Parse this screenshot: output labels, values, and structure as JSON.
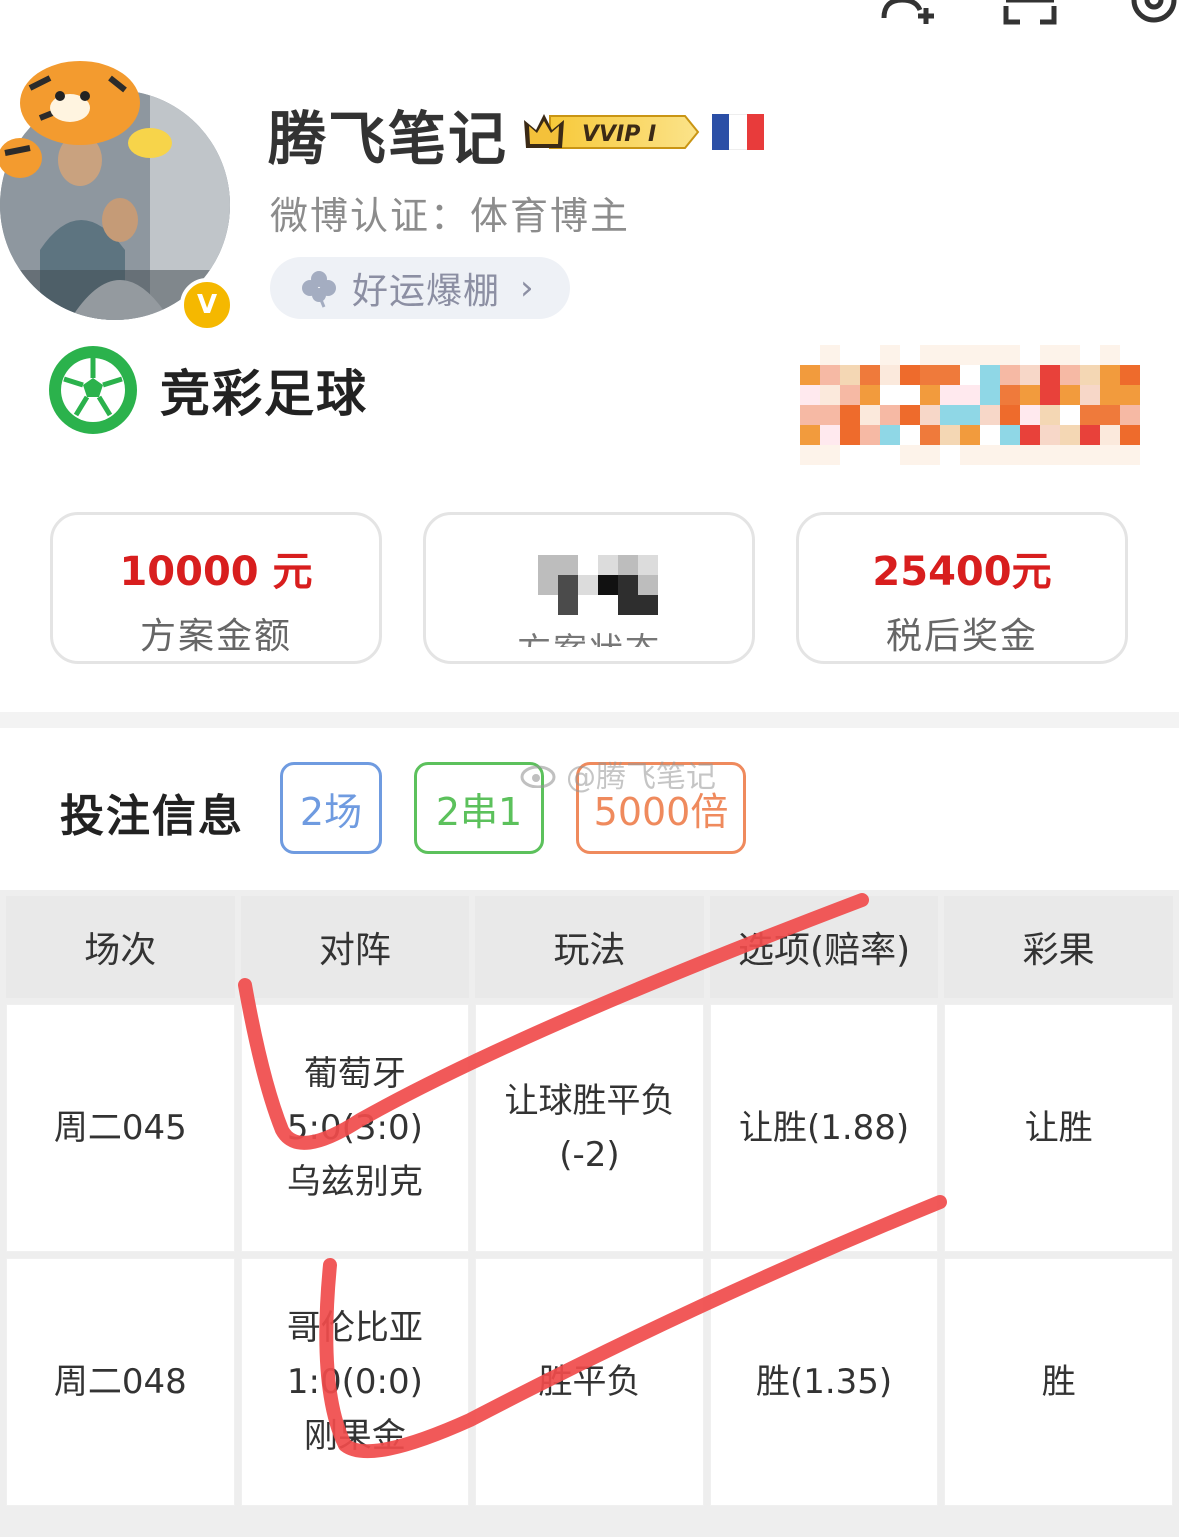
{
  "profile": {
    "username": "腾飞笔记",
    "vip_badge": "VVIP I",
    "verification": "微博认证：体育博主",
    "luck_chip": "好运爆棚",
    "verified_mark": "V"
  },
  "lottery": {
    "label": "竞彩足球"
  },
  "stats": [
    {
      "value": "10000 元",
      "label": "方案金额"
    },
    {
      "value": "",
      "label": "方案状态"
    },
    {
      "value": "25400元",
      "label": "税后奖金"
    }
  ],
  "bet_info": {
    "title": "投注信息",
    "tags": [
      "2场",
      "2串1",
      "5000倍"
    ],
    "watermark": "@腾飞笔记"
  },
  "table": {
    "headers": [
      "场次",
      "对阵",
      "玩法",
      "选项(赔率)",
      "彩果"
    ],
    "rows": [
      {
        "match_no": "周二045",
        "team_home": "葡萄牙",
        "score": "5:0(3:0)",
        "team_away": "乌兹别克",
        "play_line1": "让球胜平负",
        "play_line2": "(-2)",
        "option": "让胜(1.88)",
        "result": "让胜"
      },
      {
        "match_no": "周二048",
        "team_home": "哥伦比亚",
        "score": "1:0(0:0)",
        "team_away": "刚果金",
        "play_line1": "胜平负",
        "play_line2": "",
        "option": "胜(1.35)",
        "result": "胜"
      }
    ]
  },
  "colors": {
    "accent_red": "#d81e1e",
    "tag_blue": "#6f9be0",
    "tag_green": "#5cc15c",
    "tag_orange": "#ef8a5d",
    "scribble": "#f04b4b"
  },
  "icons": [
    "add-friend-icon",
    "scan-icon",
    "settings-icon",
    "clover-icon",
    "football-icon",
    "crown-icon",
    "chevron-right-icon"
  ]
}
